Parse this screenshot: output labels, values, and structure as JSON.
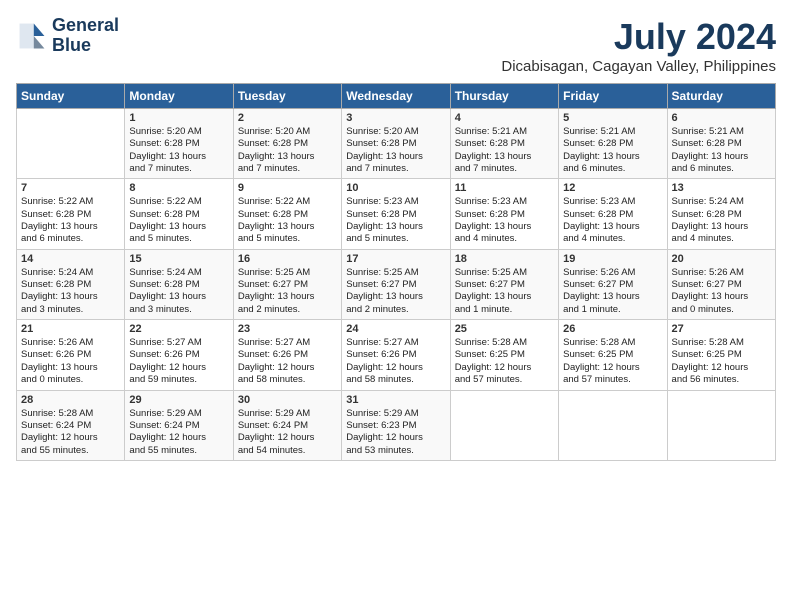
{
  "header": {
    "logo_line1": "General",
    "logo_line2": "Blue",
    "month": "July 2024",
    "location": "Dicabisagan, Cagayan Valley, Philippines"
  },
  "weekdays": [
    "Sunday",
    "Monday",
    "Tuesday",
    "Wednesday",
    "Thursday",
    "Friday",
    "Saturday"
  ],
  "weeks": [
    [
      {
        "day": "",
        "data": ""
      },
      {
        "day": "1",
        "data": "Sunrise: 5:20 AM\nSunset: 6:28 PM\nDaylight: 13 hours\nand 7 minutes."
      },
      {
        "day": "2",
        "data": "Sunrise: 5:20 AM\nSunset: 6:28 PM\nDaylight: 13 hours\nand 7 minutes."
      },
      {
        "day": "3",
        "data": "Sunrise: 5:20 AM\nSunset: 6:28 PM\nDaylight: 13 hours\nand 7 minutes."
      },
      {
        "day": "4",
        "data": "Sunrise: 5:21 AM\nSunset: 6:28 PM\nDaylight: 13 hours\nand 7 minutes."
      },
      {
        "day": "5",
        "data": "Sunrise: 5:21 AM\nSunset: 6:28 PM\nDaylight: 13 hours\nand 6 minutes."
      },
      {
        "day": "6",
        "data": "Sunrise: 5:21 AM\nSunset: 6:28 PM\nDaylight: 13 hours\nand 6 minutes."
      }
    ],
    [
      {
        "day": "7",
        "data": "Sunrise: 5:22 AM\nSunset: 6:28 PM\nDaylight: 13 hours\nand 6 minutes."
      },
      {
        "day": "8",
        "data": "Sunrise: 5:22 AM\nSunset: 6:28 PM\nDaylight: 13 hours\nand 5 minutes."
      },
      {
        "day": "9",
        "data": "Sunrise: 5:22 AM\nSunset: 6:28 PM\nDaylight: 13 hours\nand 5 minutes."
      },
      {
        "day": "10",
        "data": "Sunrise: 5:23 AM\nSunset: 6:28 PM\nDaylight: 13 hours\nand 5 minutes."
      },
      {
        "day": "11",
        "data": "Sunrise: 5:23 AM\nSunset: 6:28 PM\nDaylight: 13 hours\nand 4 minutes."
      },
      {
        "day": "12",
        "data": "Sunrise: 5:23 AM\nSunset: 6:28 PM\nDaylight: 13 hours\nand 4 minutes."
      },
      {
        "day": "13",
        "data": "Sunrise: 5:24 AM\nSunset: 6:28 PM\nDaylight: 13 hours\nand 4 minutes."
      }
    ],
    [
      {
        "day": "14",
        "data": "Sunrise: 5:24 AM\nSunset: 6:28 PM\nDaylight: 13 hours\nand 3 minutes."
      },
      {
        "day": "15",
        "data": "Sunrise: 5:24 AM\nSunset: 6:28 PM\nDaylight: 13 hours\nand 3 minutes."
      },
      {
        "day": "16",
        "data": "Sunrise: 5:25 AM\nSunset: 6:27 PM\nDaylight: 13 hours\nand 2 minutes."
      },
      {
        "day": "17",
        "data": "Sunrise: 5:25 AM\nSunset: 6:27 PM\nDaylight: 13 hours\nand 2 minutes."
      },
      {
        "day": "18",
        "data": "Sunrise: 5:25 AM\nSunset: 6:27 PM\nDaylight: 13 hours\nand 1 minute."
      },
      {
        "day": "19",
        "data": "Sunrise: 5:26 AM\nSunset: 6:27 PM\nDaylight: 13 hours\nand 1 minute."
      },
      {
        "day": "20",
        "data": "Sunrise: 5:26 AM\nSunset: 6:27 PM\nDaylight: 13 hours\nand 0 minutes."
      }
    ],
    [
      {
        "day": "21",
        "data": "Sunrise: 5:26 AM\nSunset: 6:26 PM\nDaylight: 13 hours\nand 0 minutes."
      },
      {
        "day": "22",
        "data": "Sunrise: 5:27 AM\nSunset: 6:26 PM\nDaylight: 12 hours\nand 59 minutes."
      },
      {
        "day": "23",
        "data": "Sunrise: 5:27 AM\nSunset: 6:26 PM\nDaylight: 12 hours\nand 58 minutes."
      },
      {
        "day": "24",
        "data": "Sunrise: 5:27 AM\nSunset: 6:26 PM\nDaylight: 12 hours\nand 58 minutes."
      },
      {
        "day": "25",
        "data": "Sunrise: 5:28 AM\nSunset: 6:25 PM\nDaylight: 12 hours\nand 57 minutes."
      },
      {
        "day": "26",
        "data": "Sunrise: 5:28 AM\nSunset: 6:25 PM\nDaylight: 12 hours\nand 57 minutes."
      },
      {
        "day": "27",
        "data": "Sunrise: 5:28 AM\nSunset: 6:25 PM\nDaylight: 12 hours\nand 56 minutes."
      }
    ],
    [
      {
        "day": "28",
        "data": "Sunrise: 5:28 AM\nSunset: 6:24 PM\nDaylight: 12 hours\nand 55 minutes."
      },
      {
        "day": "29",
        "data": "Sunrise: 5:29 AM\nSunset: 6:24 PM\nDaylight: 12 hours\nand 55 minutes."
      },
      {
        "day": "30",
        "data": "Sunrise: 5:29 AM\nSunset: 6:24 PM\nDaylight: 12 hours\nand 54 minutes."
      },
      {
        "day": "31",
        "data": "Sunrise: 5:29 AM\nSunset: 6:23 PM\nDaylight: 12 hours\nand 53 minutes."
      },
      {
        "day": "",
        "data": ""
      },
      {
        "day": "",
        "data": ""
      },
      {
        "day": "",
        "data": ""
      }
    ]
  ]
}
